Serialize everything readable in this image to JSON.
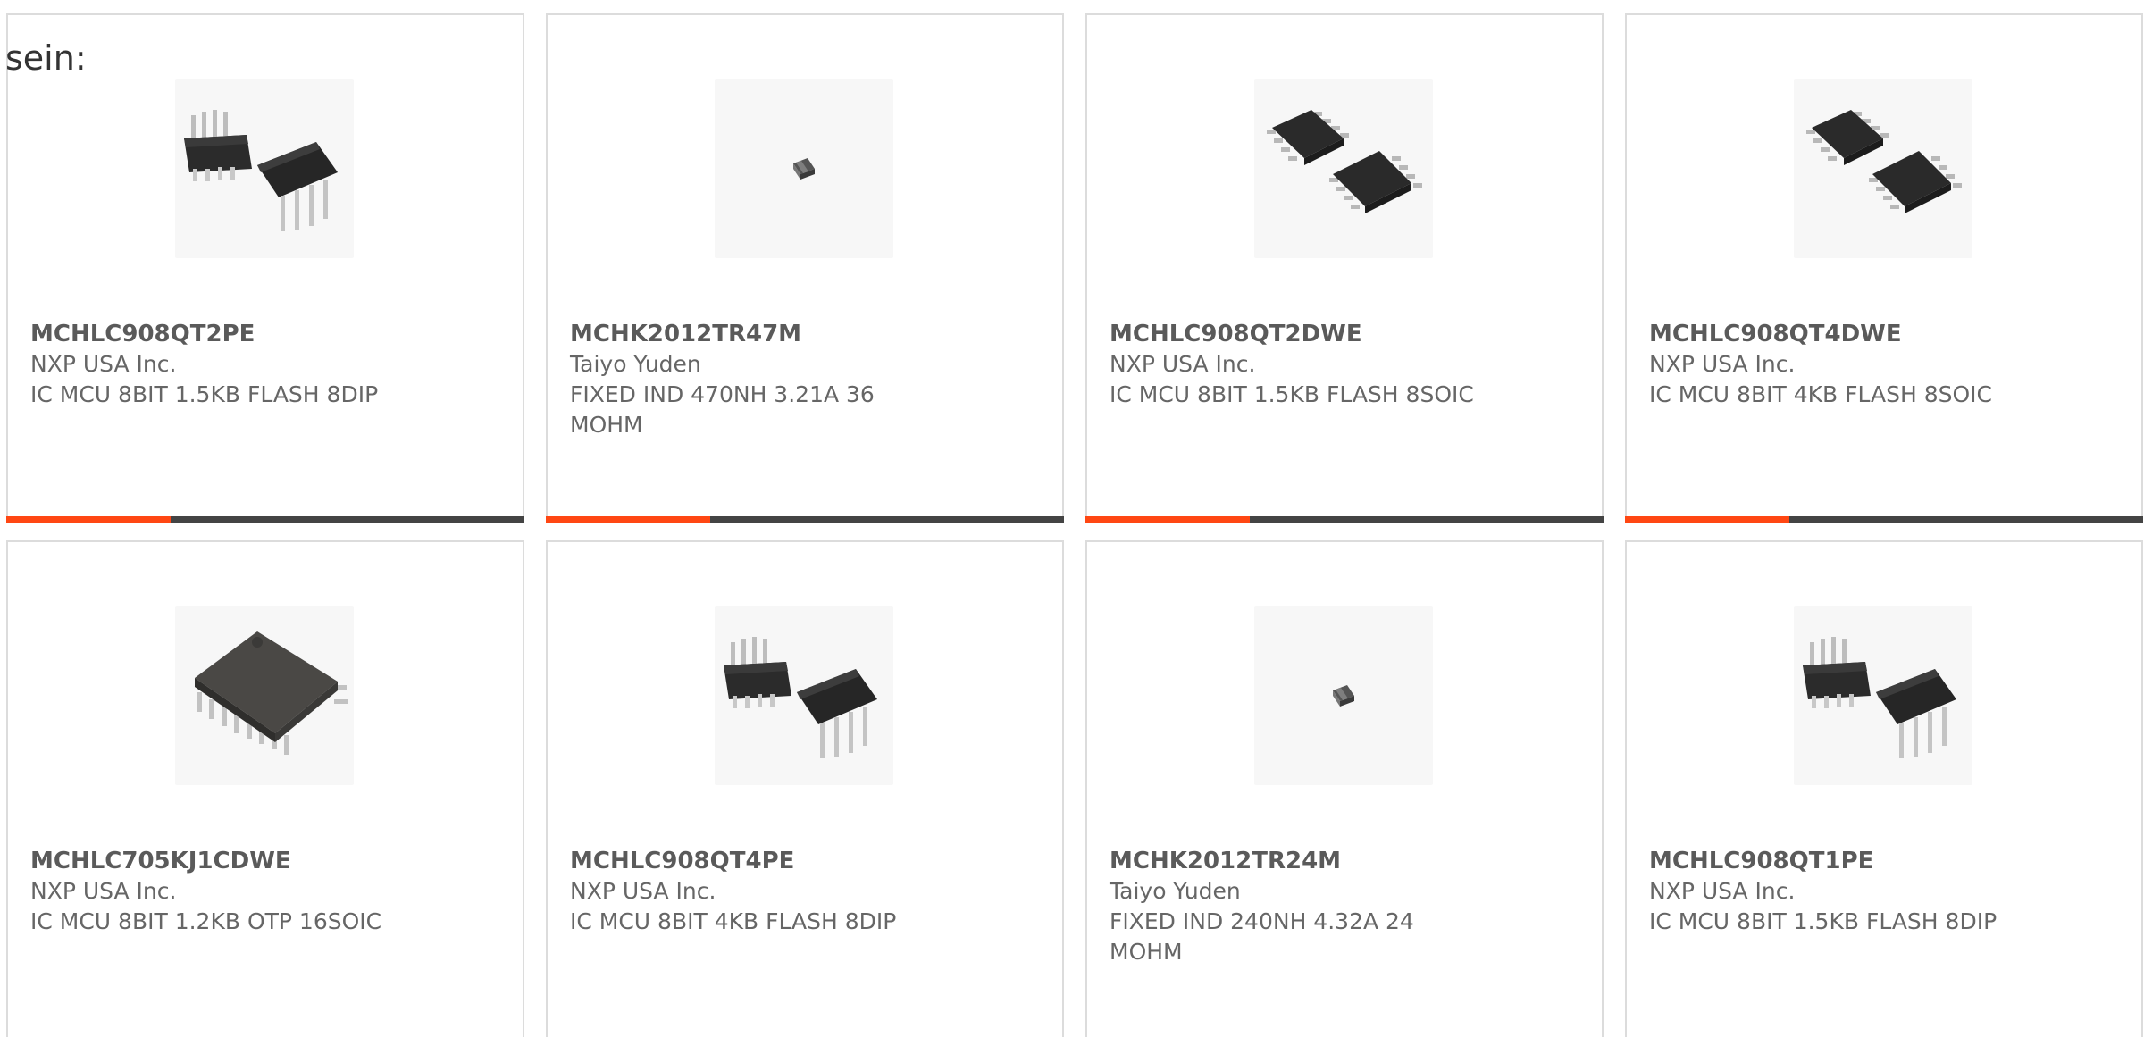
{
  "intro": {
    "label": "sein:"
  },
  "colors": {
    "accent": "#ff4713",
    "bar": "#444444",
    "border": "#dcdcdc",
    "text": "#666666"
  },
  "products": [
    {
      "part_number": "MCHLC908QT2PE",
      "manufacturer": "NXP USA Inc.",
      "description": "IC MCU 8BIT 1.5KB FLASH 8DIP",
      "image": "dip-8-package-icon"
    },
    {
      "part_number": "MCHK2012TR47M",
      "manufacturer": "Taiyo Yuden",
      "description": "FIXED IND 470NH 3.21A 36 MOHM",
      "image": "smd-chip-inductor-icon"
    },
    {
      "part_number": "MCHLC908QT2DWE",
      "manufacturer": "NXP USA Inc.",
      "description": "IC MCU 8BIT 1.5KB FLASH 8SOIC",
      "image": "soic-8-package-icon"
    },
    {
      "part_number": "MCHLC908QT4DWE",
      "manufacturer": "NXP USA Inc.",
      "description": "IC MCU 8BIT 4KB FLASH 8SOIC",
      "image": "soic-8-package-icon"
    },
    {
      "part_number": "MCHLC705KJ1CDWE",
      "manufacturer": "NXP USA Inc.",
      "description": "IC MCU 8BIT 1.2KB OTP 16SOIC",
      "image": "soic-16-package-icon"
    },
    {
      "part_number": "MCHLC908QT4PE",
      "manufacturer": "NXP USA Inc.",
      "description": "IC MCU 8BIT 4KB FLASH 8DIP",
      "image": "dip-8-package-icon"
    },
    {
      "part_number": "MCHK2012TR24M",
      "manufacturer": "Taiyo Yuden",
      "description": "FIXED IND 240NH 4.32A 24 MOHM",
      "image": "smd-chip-inductor-icon"
    },
    {
      "part_number": "MCHLC908QT1PE",
      "manufacturer": "NXP USA Inc.",
      "description": "IC MCU 8BIT 1.5KB FLASH 8DIP",
      "image": "dip-8-package-icon"
    }
  ]
}
